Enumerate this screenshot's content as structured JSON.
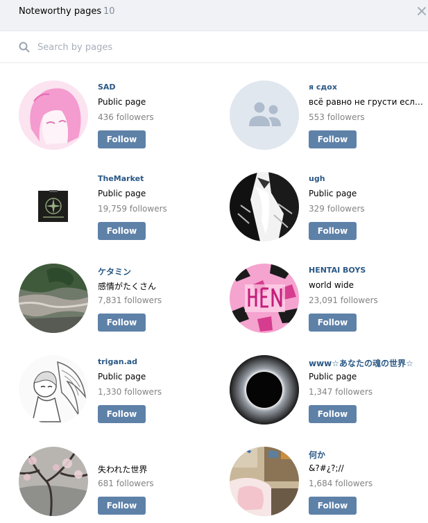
{
  "header": {
    "title": "Noteworthy pages",
    "count": "10"
  },
  "search": {
    "placeholder": "Search by pages",
    "value": ""
  },
  "colors": {
    "accent": "#5e81a8",
    "link": "#2a5885",
    "muted": "#828282",
    "header_bg": "#f0f2f5"
  },
  "pages": [
    {
      "name": "SAD",
      "description": "Public page",
      "followers": "436 followers",
      "follow_label": "Follow",
      "avatar_icon": "pink-anime-girl-avatar"
    },
    {
      "name": "я сдох",
      "description": "всё равно не грусти если з...",
      "followers": "553 followers",
      "follow_label": "Follow",
      "avatar_icon": "community-placeholder-icon"
    },
    {
      "name": "TheMarket",
      "description": "Public page",
      "followers": "19,759 followers",
      "follow_label": "Follow",
      "avatar_icon": "compass-patch-avatar"
    },
    {
      "name": "ugh",
      "description": "Public page",
      "followers": "329 followers",
      "follow_label": "Follow",
      "avatar_icon": "manga-bw-avatar"
    },
    {
      "name": "ケタミン",
      "description": "感情がたくさん",
      "followers": "7,831 followers",
      "follow_label": "Follow",
      "avatar_icon": "river-photo-avatar"
    },
    {
      "name": "HENTAI BOYS",
      "description": "world wide",
      "followers": "23,091 followers",
      "follow_label": "Follow",
      "avatar_icon": "pink-camo-avatar"
    },
    {
      "name": "trigan.ad",
      "description": "Public page",
      "followers": "1,330 followers",
      "follow_label": "Follow",
      "avatar_icon": "winged-sketch-avatar"
    },
    {
      "name": "www☆あなたの魂の世界☆",
      "description": "Public page",
      "followers": "1,347 followers",
      "follow_label": "Follow",
      "avatar_icon": "eclipse-avatar"
    },
    {
      "name": "",
      "description": "失われた世界",
      "followers": "681 followers",
      "follow_label": "Follow",
      "avatar_icon": "cherry-blossom-avatar"
    },
    {
      "name": "何か",
      "description": "&?#¿?;//",
      "followers": "1,684 followers",
      "follow_label": "Follow",
      "avatar_icon": "anime-room-avatar"
    }
  ]
}
